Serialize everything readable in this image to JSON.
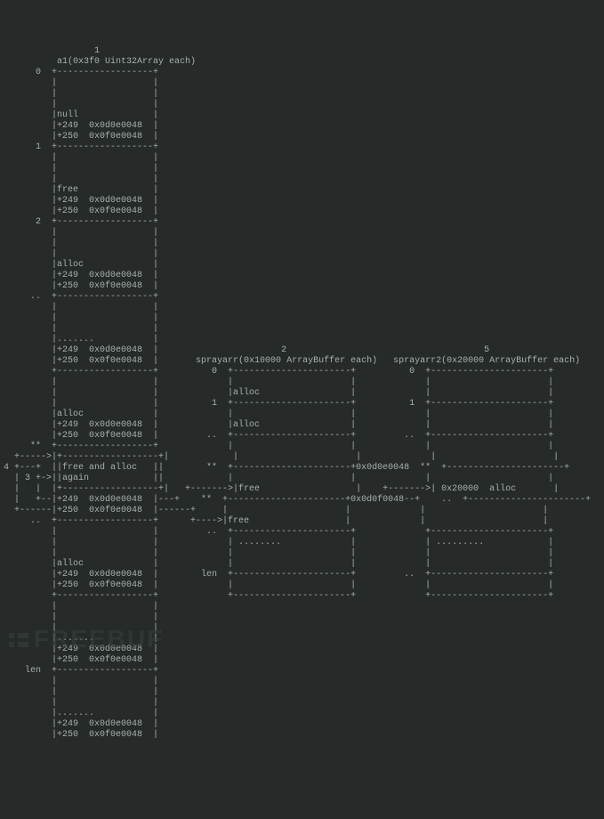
{
  "columns": {
    "a1": {
      "index": "1",
      "title": "a1(0x3f0 Uint32Array each)"
    },
    "sprayarr": {
      "index": "2",
      "title": "sprayarr(0x10000 ArrayBuffer each)"
    },
    "sprayarr2": {
      "index": "5",
      "title": "sprayarr2(0x20000 ArrayBuffer each)"
    }
  },
  "a1_blocks": [
    {
      "row": "0",
      "head": null,
      "l249": "0x0d0e0048",
      "l250": "0x0f0e0048",
      "tag": "null"
    },
    {
      "row": "1",
      "head": null,
      "l249": "0x0d0e0048",
      "l250": "0x0f0e0048",
      "tag": "free"
    },
    {
      "row": "2",
      "head": null,
      "l249": "0x0d0e0048",
      "l250": "0x0f0e0048",
      "tag": "alloc"
    },
    {
      "row": "..",
      "head": ".......",
      "l249": "0x0d0e0048",
      "l250": "0x0f0e0048",
      "tag": null
    },
    {
      "row": "**",
      "head": null,
      "l249": "0x0d0e0048",
      "l250": "0x0f0e0048",
      "tag": "alloc"
    },
    {
      "row": "..",
      "head": "free and alloc",
      "head2": "again",
      "l249": "0x0d0e0048",
      "l250": "0x0f0e0048",
      "tag": null,
      "step_left": [
        "4",
        "3"
      ]
    },
    {
      "row": null,
      "head": null,
      "l249": "0x0d0e0048",
      "l250": "0x0f0e0048",
      "tag": "alloc"
    },
    {
      "row": "len",
      "head": ".......",
      "l249": "0x0d0e0048",
      "l250": "0x0f0e0048",
      "tag": null
    },
    {
      "row": null,
      "head": ".......",
      "l249": "0x0d0e0048",
      "l250": "0x0f0e0048",
      "tag": null
    }
  ],
  "sprayarr_blocks": [
    {
      "row": "0",
      "tag": null
    },
    {
      "row": "1",
      "tag": "alloc"
    },
    {
      "row": "..",
      "tag": "alloc"
    },
    {
      "row": "**",
      "tag": null,
      "note_right": "+0x0d0e0048"
    },
    {
      "row": "**",
      "tag": "free",
      "note_right": "+0x0d0f0048"
    },
    {
      "row": "..",
      "tag": "free"
    },
    {
      "row": "len",
      "tag": "........"
    },
    {
      "row": null,
      "tag": null
    }
  ],
  "sprayarr2_blocks": [
    {
      "row": "0",
      "tag": null
    },
    {
      "row": "1",
      "tag": null
    },
    {
      "row": "..",
      "tag": null
    },
    {
      "row": "**",
      "tag": null
    },
    {
      "row": "..",
      "tag": "0x20000  alloc",
      "arrow_in": true
    },
    {
      "row": null,
      "tag": null
    },
    {
      "row": "..",
      "tag": "........."
    },
    {
      "row": null,
      "tag": null
    }
  ],
  "watermark": "FREEBUF"
}
